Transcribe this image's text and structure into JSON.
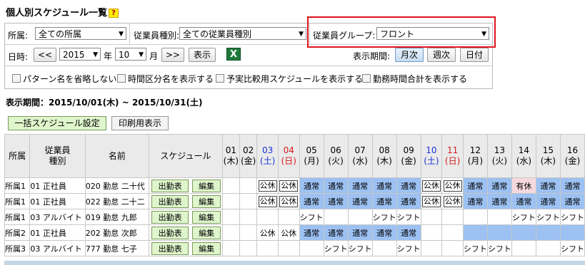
{
  "page": {
    "title": "個人別スケジュール一覧",
    "help_label": "?",
    "period_text": "表示期間：2015/10/01(木) ~ 2015/10/31(土)"
  },
  "filters": {
    "affiliation_label": "所属:",
    "affiliation_value": "全ての所属",
    "employee_type_label": "従業員種別:",
    "employee_type_value": "全ての従業員種別",
    "employee_group_label": "従業員グループ:",
    "employee_group_value": "フロント",
    "date_label": "日時:",
    "prev_label": "<<",
    "year_value": "2015",
    "year_unit": "年",
    "month_value": "10",
    "month_unit": "月",
    "next_label": ">>",
    "show_label": "表示",
    "period_label": "表示期間:",
    "period_options": [
      "月次",
      "週次",
      "日付"
    ],
    "period_selected": "月次",
    "checkboxes": [
      "パターン名を省略しない",
      "時間区分名を表示する",
      "予実比較用スケジュールを表示する",
      "勤務時間合計を表示する"
    ]
  },
  "actions": {
    "bulk_schedule_label": "一括スケジュール設定",
    "print_view_label": "印刷用表示"
  },
  "table": {
    "headers": {
      "affiliation": "所属",
      "employee_type": "従業員\n種別",
      "name": "名前",
      "schedule": "スケジュール"
    },
    "days": [
      {
        "d": "01",
        "w": "(木)",
        "t": "normal"
      },
      {
        "d": "02",
        "w": "(金)",
        "t": "normal"
      },
      {
        "d": "03",
        "w": "(土)",
        "t": "sat"
      },
      {
        "d": "04",
        "w": "(日)",
        "t": "sun"
      },
      {
        "d": "05",
        "w": "(月)",
        "t": "normal"
      },
      {
        "d": "06",
        "w": "(火)",
        "t": "normal"
      },
      {
        "d": "07",
        "w": "(水)",
        "t": "normal"
      },
      {
        "d": "08",
        "w": "(木)",
        "t": "normal"
      },
      {
        "d": "09",
        "w": "(金)",
        "t": "normal"
      },
      {
        "d": "10",
        "w": "(土)",
        "t": "sat"
      },
      {
        "d": "11",
        "w": "(日)",
        "t": "sun"
      },
      {
        "d": "12",
        "w": "(月)",
        "t": "normal"
      },
      {
        "d": "13",
        "w": "(火)",
        "t": "normal"
      },
      {
        "d": "14",
        "w": "(水)",
        "t": "normal"
      },
      {
        "d": "15",
        "w": "(木)",
        "t": "normal"
      },
      {
        "d": "16",
        "w": "(金)",
        "t": "normal"
      }
    ],
    "attendance_label": "出勤表",
    "edit_label": "編集",
    "rows": [
      {
        "affiliation": "所属1",
        "type": "01 正社員",
        "name": "020 勤怠 二十代",
        "cells": [
          {
            "v": "",
            "s": ""
          },
          {
            "v": "",
            "s": ""
          },
          {
            "v": "公休",
            "s": "box"
          },
          {
            "v": "公休",
            "s": "box"
          },
          {
            "v": "通常",
            "s": "blue"
          },
          {
            "v": "通常",
            "s": "blue"
          },
          {
            "v": "通常",
            "s": "blue"
          },
          {
            "v": "通常",
            "s": "blue"
          },
          {
            "v": "通常",
            "s": "blue"
          },
          {
            "v": "公休",
            "s": "box"
          },
          {
            "v": "公休",
            "s": "box"
          },
          {
            "v": "通常",
            "s": "blue"
          },
          {
            "v": "通常",
            "s": "blue"
          },
          {
            "v": "有休",
            "s": "pink"
          },
          {
            "v": "通常",
            "s": "blue"
          },
          {
            "v": "通常",
            "s": "blue"
          }
        ]
      },
      {
        "affiliation": "所属1",
        "type": "01 正社員",
        "name": "022 勤怠 二十二",
        "cells": [
          {
            "v": "",
            "s": ""
          },
          {
            "v": "",
            "s": ""
          },
          {
            "v": "公休",
            "s": "box"
          },
          {
            "v": "公休",
            "s": "box"
          },
          {
            "v": "通常",
            "s": "blue"
          },
          {
            "v": "通常",
            "s": "blue"
          },
          {
            "v": "通常",
            "s": "blue"
          },
          {
            "v": "通常",
            "s": "blue"
          },
          {
            "v": "通常",
            "s": "blue"
          },
          {
            "v": "公休",
            "s": "box"
          },
          {
            "v": "公休",
            "s": "box"
          },
          {
            "v": "通常",
            "s": "blue"
          },
          {
            "v": "通常",
            "s": "blue"
          },
          {
            "v": "通常",
            "s": "blue"
          },
          {
            "v": "通常",
            "s": "blue"
          },
          {
            "v": "通常",
            "s": "blue"
          }
        ]
      },
      {
        "affiliation": "所属1",
        "type": "03 アルバイト",
        "name": "019 勤怠 九郎",
        "cells": [
          {
            "v": "",
            "s": ""
          },
          {
            "v": "",
            "s": ""
          },
          {
            "v": "",
            "s": ""
          },
          {
            "v": "",
            "s": ""
          },
          {
            "v": "シフト",
            "s": ""
          },
          {
            "v": "",
            "s": ""
          },
          {
            "v": "",
            "s": ""
          },
          {
            "v": "シフト",
            "s": ""
          },
          {
            "v": "シフト",
            "s": ""
          },
          {
            "v": "",
            "s": ""
          },
          {
            "v": "",
            "s": ""
          },
          {
            "v": "",
            "s": ""
          },
          {
            "v": "",
            "s": ""
          },
          {
            "v": "シフト",
            "s": ""
          },
          {
            "v": "シフト",
            "s": ""
          },
          {
            "v": "シフト",
            "s": ""
          }
        ]
      },
      {
        "affiliation": "所属2",
        "type": "01 正社員",
        "name": "202 勤怠 次郎",
        "cells": [
          {
            "v": "",
            "s": ""
          },
          {
            "v": "",
            "s": ""
          },
          {
            "v": "公休",
            "s": ""
          },
          {
            "v": "公休",
            "s": ""
          },
          {
            "v": "通常",
            "s": "blue"
          },
          {
            "v": "通常",
            "s": "blue"
          },
          {
            "v": "通常",
            "s": "blue"
          },
          {
            "v": "通常",
            "s": "blue"
          },
          {
            "v": "通常",
            "s": "blue"
          },
          {
            "v": "",
            "s": ""
          },
          {
            "v": "",
            "s": ""
          },
          {
            "v": "",
            "s": "blue"
          },
          {
            "v": "",
            "s": "blue"
          },
          {
            "v": "",
            "s": "blue"
          },
          {
            "v": "",
            "s": "blue"
          },
          {
            "v": "",
            "s": "blue"
          }
        ]
      },
      {
        "affiliation": "所属3",
        "type": "03 アルバイト",
        "name": "777 勤怠 七子",
        "cells": [
          {
            "v": "",
            "s": ""
          },
          {
            "v": "",
            "s": ""
          },
          {
            "v": "",
            "s": ""
          },
          {
            "v": "",
            "s": ""
          },
          {
            "v": "",
            "s": ""
          },
          {
            "v": "シフト",
            "s": ""
          },
          {
            "v": "シフト",
            "s": ""
          },
          {
            "v": "",
            "s": ""
          },
          {
            "v": "シフト",
            "s": ""
          },
          {
            "v": "",
            "s": ""
          },
          {
            "v": "",
            "s": ""
          },
          {
            "v": "シフト",
            "s": ""
          },
          {
            "v": "シフト",
            "s": ""
          },
          {
            "v": "",
            "s": ""
          },
          {
            "v": "",
            "s": ""
          },
          {
            "v": "シフト",
            "s": ""
          }
        ]
      }
    ]
  }
}
